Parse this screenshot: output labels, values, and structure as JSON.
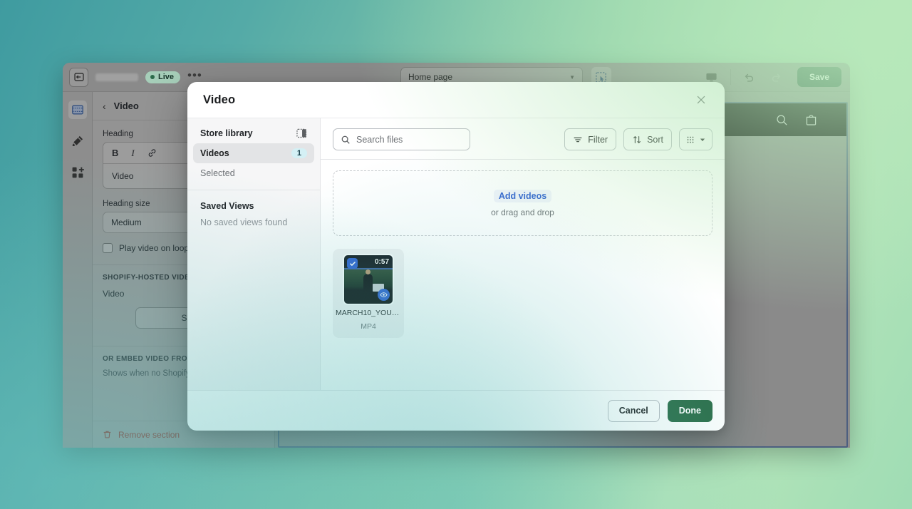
{
  "colors": {
    "accent_green": "#2c6e49",
    "save_green": "#1e4b36",
    "link_blue": "#2c5ecf",
    "badge_blue": "#d4f0f5",
    "danger_red": "#8b2a20",
    "backdrop_teal": "#3f9ba0",
    "backdrop_green": "#b7e6ba"
  },
  "topbar": {
    "exit_icon": "exit-icon",
    "store_name": "",
    "live_label": "Live",
    "more_label": "•••",
    "page_selector": {
      "value": "Home page",
      "caret_icon": "chevron-down-icon"
    },
    "inspect_icon": "inspector-icon",
    "device_icon": "desktop-icon",
    "undo_icon": "undo-icon",
    "redo_icon": "redo-icon",
    "save_label": "Save"
  },
  "rail": {
    "items": [
      {
        "icon": "sections-icon",
        "name": "sections",
        "active": true
      },
      {
        "icon": "paint-brush-icon",
        "name": "theme-settings",
        "active": false
      },
      {
        "icon": "apps-blocks-icon",
        "name": "apps",
        "active": false
      }
    ]
  },
  "sidebar": {
    "back_icon": "chevron-left-icon",
    "title": "Video",
    "heading_label": "Heading",
    "rich_text_tools": [
      "B",
      "I",
      "link-icon"
    ],
    "heading_value": "Video",
    "heading_size_label": "Heading size",
    "heading_size_value": "Medium",
    "loop_label": "Play video on loop",
    "hosted_section_title": "SHOPIFY-HOSTED VIDEO",
    "video_label": "Video",
    "select_video_label": "Select vid",
    "embed_section_title": "OR EMBED VIDEO FROM U",
    "embed_help": "Shows when no Shopify-   selected.",
    "remove_icon": "trash-icon",
    "remove_label": "Remove section"
  },
  "preview": {
    "search_icon": "search-icon",
    "cart_icon": "cart-icon"
  },
  "modal": {
    "title": "Video",
    "close_icon": "close-icon",
    "sidebar": {
      "store_library_label": "Store library",
      "panel_toggle_icon": "panel-toggle-icon",
      "items": [
        {
          "label": "Videos",
          "badge": "1",
          "selected": true
        },
        {
          "label": "Selected",
          "badge": "",
          "selected": false
        }
      ],
      "saved_views_title": "Saved Views",
      "saved_views_empty": "No saved views found"
    },
    "toolbar": {
      "search_placeholder": "Search files",
      "search_value": "",
      "search_icon": "search-icon",
      "filter_label": "Filter",
      "filter_icon": "filter-icon",
      "sort_label": "Sort",
      "sort_icon": "sort-arrows-icon",
      "view_icon": "grid-view-icon",
      "view_caret_icon": "chevron-down-icon"
    },
    "dropzone": {
      "add_label": "Add videos",
      "drag_label": "or drag and drop"
    },
    "files": [
      {
        "name": "MARCH10_YOUT...",
        "type": "MP4",
        "duration": "0:57",
        "selected": true,
        "check_icon": "checkmark-icon",
        "preview_icon": "eye-icon"
      }
    ],
    "footer": {
      "cancel_label": "Cancel",
      "done_label": "Done"
    }
  }
}
